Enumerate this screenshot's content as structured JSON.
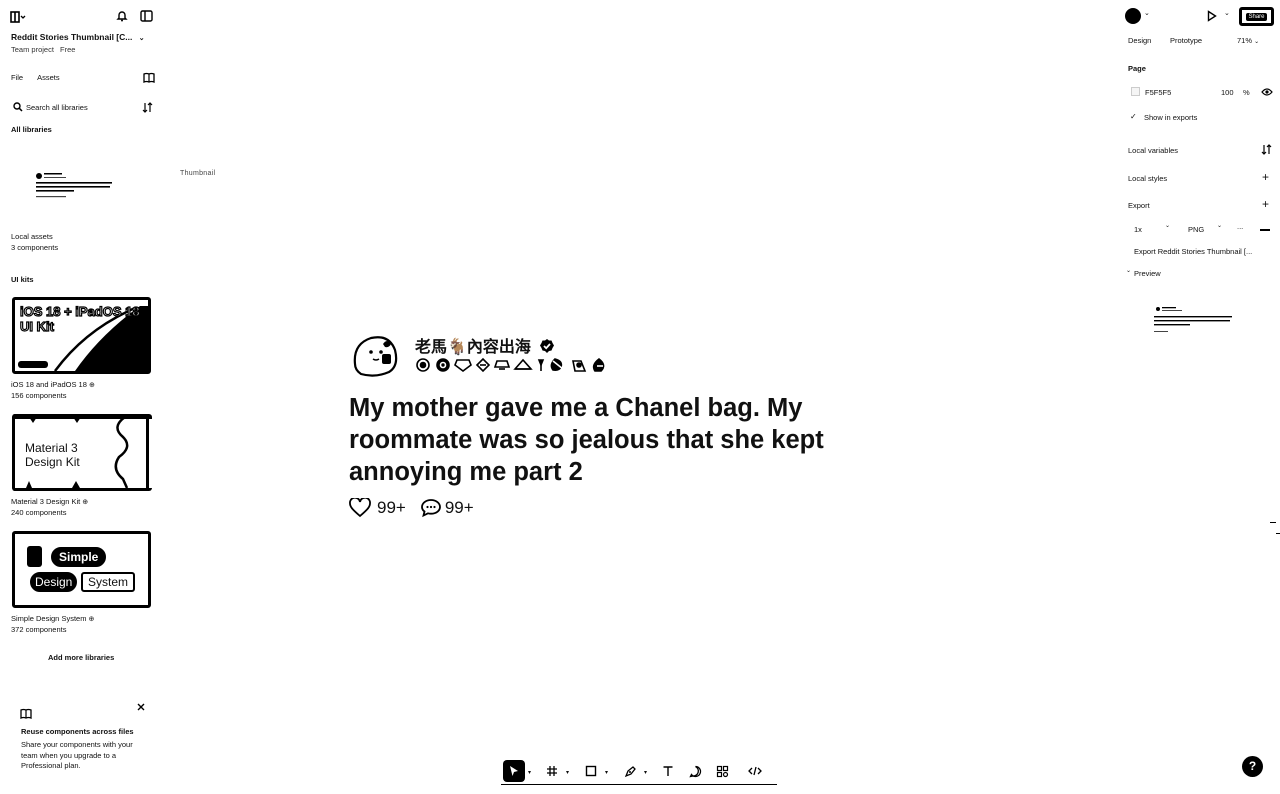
{
  "left_panel": {
    "file_title": "Reddit Stories Thumbnail [C...",
    "project": "Team project",
    "plan": "Free",
    "tabs": [
      "File",
      "Assets"
    ],
    "search_placeholder": "Search all libraries",
    "all_libraries_heading": "All libraries",
    "local_assets_label": "Local assets",
    "local_assets_count": "3 components",
    "ui_kits_heading": "UI kits",
    "kits": [
      {
        "name": "iOS 18 and iPadOS 18",
        "count": "156 components",
        "card_text": "iOS 18 + iPadOS 18 UI Kit"
      },
      {
        "name": "Material 3 Design Kit",
        "count": "240 components",
        "card_text_1": "Material 3",
        "card_text_2": "Design Kit"
      },
      {
        "name": "Simple Design System",
        "count": "372 components",
        "card_text_1": "Simple",
        "card_text_2": "Design",
        "card_text_3": "System"
      }
    ],
    "add_more_libraries": "Add more libraries",
    "reuse_title": "Reuse components across files",
    "reuse_body": "Share your components with your team when you upgrade to a Professional plan."
  },
  "canvas": {
    "frame_label": "Thumbnail",
    "author": "老馬🐐內容出海",
    "post_title": "My mother gave me a Chanel bag. My roommate was so jealous that she kept annoying me part 2",
    "likes": "99+",
    "comments": "99+"
  },
  "right_panel": {
    "share_label": "Share",
    "tabs": [
      "Design",
      "Prototype"
    ],
    "zoom": "71%",
    "page_heading": "Page",
    "page_color": "F5F5F5",
    "page_opacity": "100",
    "percent_sign": "%",
    "show_in_exports": "Show in exports",
    "local_variables": "Local variables",
    "local_styles": "Local styles",
    "export_heading": "Export",
    "export_scale": "1x",
    "export_format": "PNG",
    "export_more": "...",
    "export_button": "Export Reddit Stories Thumbnail [...",
    "preview_heading": "Preview"
  },
  "help_label": "?"
}
